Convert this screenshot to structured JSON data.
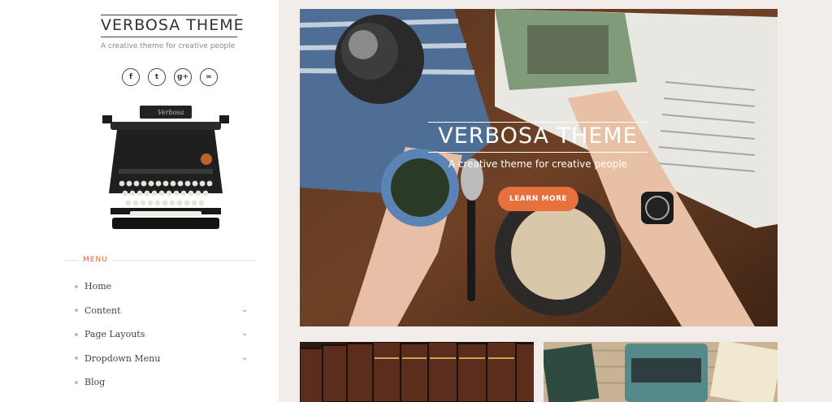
{
  "site": {
    "title": "VERBOSA THEME",
    "tagline": "A creative theme for creative people",
    "logo_text": "Verbosa"
  },
  "social": [
    {
      "icon": "facebook-icon",
      "glyph": "f"
    },
    {
      "icon": "twitter-icon",
      "glyph": "t"
    },
    {
      "icon": "google-plus-icon",
      "glyph": "g+"
    },
    {
      "icon": "link-icon",
      "glyph": "∞"
    }
  ],
  "menu": {
    "heading": "MENU",
    "items": [
      {
        "label": "Home",
        "has_submenu": false
      },
      {
        "label": "Content",
        "has_submenu": true
      },
      {
        "label": "Page Layouts",
        "has_submenu": true
      },
      {
        "label": "Dropdown Menu",
        "has_submenu": true
      },
      {
        "label": "Blog",
        "has_submenu": false
      }
    ]
  },
  "hero": {
    "title": "VERBOSA THEME",
    "subtitle": "A creative theme for creative people",
    "button": "LEARN MORE"
  },
  "colors": {
    "accent": "#e8703c",
    "background": "#f2ecea"
  }
}
